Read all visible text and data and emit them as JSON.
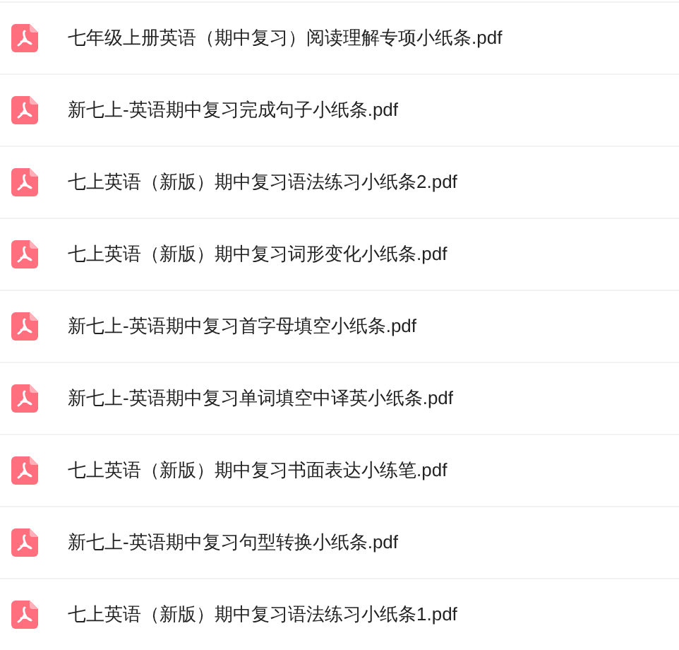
{
  "files": [
    {
      "name": "七年级上册英语（期中复习）阅读理解专项小纸条.pdf"
    },
    {
      "name": "新七上-英语期中复习完成句子小纸条.pdf"
    },
    {
      "name": "七上英语（新版）期中复习语法练习小纸条2.pdf"
    },
    {
      "name": "七上英语（新版）期中复习词形变化小纸条.pdf"
    },
    {
      "name": "新七上-英语期中复习首字母填空小纸条.pdf"
    },
    {
      "name": "新七上-英语期中复习单词填空中译英小纸条.pdf"
    },
    {
      "name": "七上英语（新版）期中复习书面表达小练笔.pdf"
    },
    {
      "name": "新七上-英语期中复习句型转换小纸条.pdf"
    },
    {
      "name": "七上英语（新版）期中复习语法练习小纸条1.pdf"
    }
  ]
}
